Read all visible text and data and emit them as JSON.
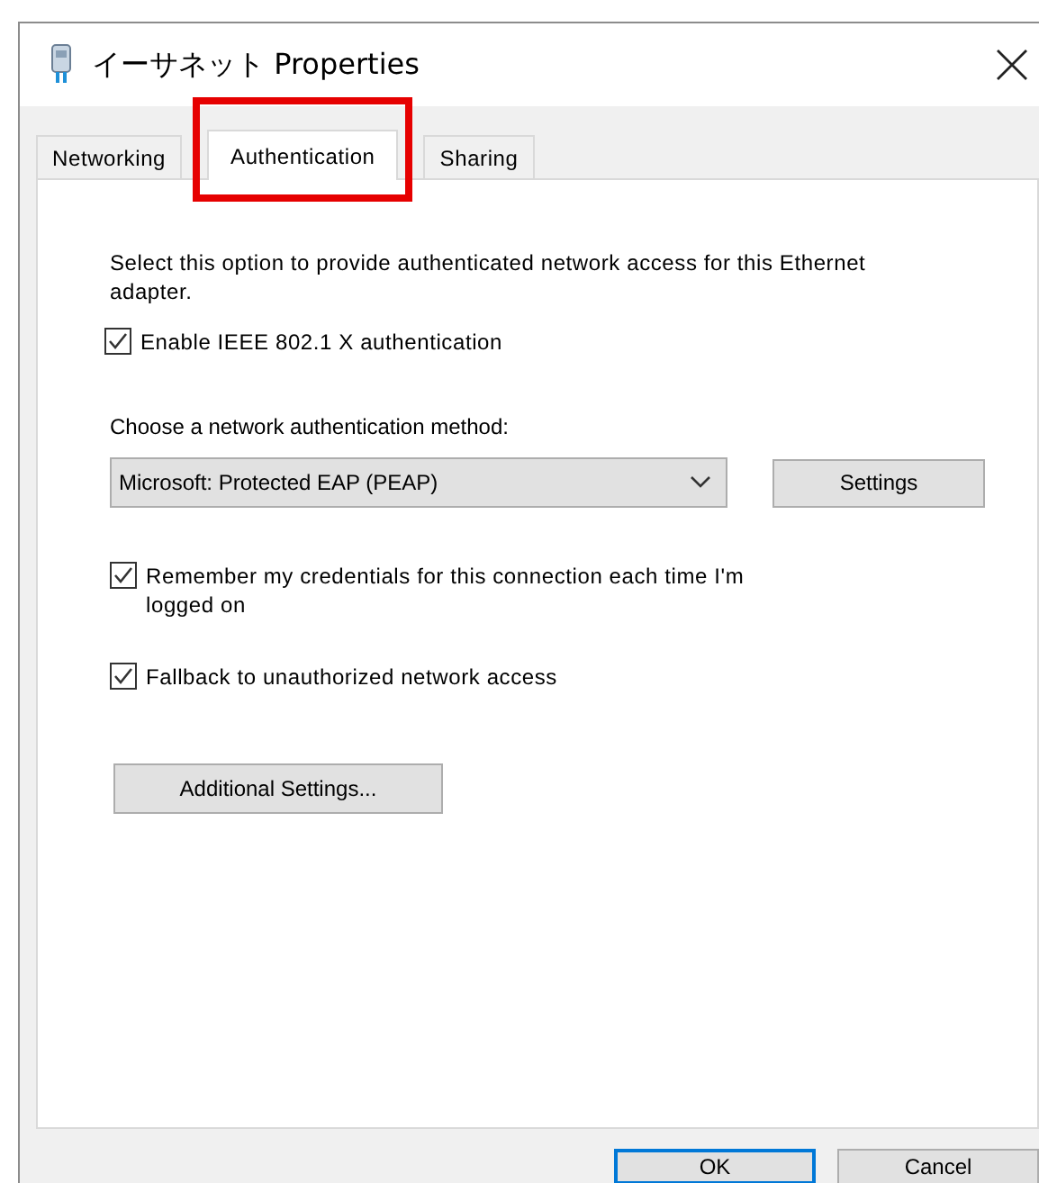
{
  "window": {
    "title": "イーサネット Properties"
  },
  "tabs": [
    {
      "label": "Networking",
      "selected": false
    },
    {
      "label": "Authentication",
      "selected": true
    },
    {
      "label": "Sharing",
      "selected": false
    }
  ],
  "description": "Select this option to provide authenticated network access for this Ethernet adapter.",
  "enable_8021x": {
    "label": "Enable IEEE 802.1 X authentication",
    "checked": true
  },
  "method": {
    "label": "Choose a network authentication method:",
    "value": "Microsoft: Protected EAP (PEAP)"
  },
  "settings_button": "Settings",
  "options": [
    {
      "label": "Remember my credentials for this connection each time I'm logged on",
      "checked": true
    },
    {
      "label": "Fallback to unauthorized network access",
      "checked": true
    }
  ],
  "additional_button": "Additional Settings...",
  "buttons": [
    {
      "label": "OK",
      "default": true
    },
    {
      "label": "Cancel",
      "default": false
    }
  ]
}
